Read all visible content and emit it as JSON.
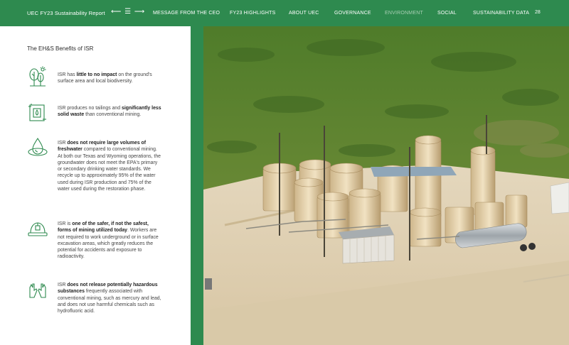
{
  "header": {
    "report_title": "UEC FY23 Sustainability Report",
    "nav_controls": "⟵ ☰ ⟶",
    "nav": [
      {
        "label": "MESSAGE FROM THE CEO",
        "active": false
      },
      {
        "label": "FY23 HIGHLIGHTS",
        "active": false
      },
      {
        "label": "ABOUT UEC",
        "active": false
      },
      {
        "label": "GOVERNANCE",
        "active": false
      },
      {
        "label": "ENVIRONMENT",
        "active": true
      },
      {
        "label": "SOCIAL",
        "active": false
      },
      {
        "label": "SUSTAINABILITY DATA",
        "active": false
      }
    ],
    "page_number": "28"
  },
  "section": {
    "title": "The EH&S Benefits of ISR",
    "items": [
      {
        "icon": "tree-sun-icon",
        "pre": "ISR has ",
        "bold": "little to no impact",
        "post": " on the ground's surface area and local biodiversity."
      },
      {
        "icon": "mining-waste-icon",
        "pre": "ISR produces no tailings and ",
        "bold": "significantly less solid waste",
        "post": " than conventional mining."
      },
      {
        "icon": "water-drop-icon",
        "pre": "ISR ",
        "bold": "does not require large volumes of freshwater",
        "post": " compared to conventional mining. At both our Texas and Wyoming operations, the groundwater does not meet the EPA's primary or secondary drinking water standards. We recycle up to approximately 95% of the water used during ISR production and 75% of the water used during the restoration phase."
      },
      {
        "icon": "hard-hat-icon",
        "pre": "ISR is ",
        "bold": "one of the safer, if not the safest, forms of mining utilized today",
        "post": ". Workers are not required to work underground or in surface excavation areas, which greatly reduces the potential for accidents and exposure to radioactivity."
      },
      {
        "icon": "hands-icon",
        "pre": "ISR ",
        "bold": "does not release potentially hazardous substances",
        "post": " frequently associated with conventional mining, such as mercury and lead, and does not use harmful chemicals such as hydrofluoric acid."
      }
    ]
  },
  "colors": {
    "brand_green": "#2e8a4f",
    "icon_green": "#2e8a4f"
  }
}
